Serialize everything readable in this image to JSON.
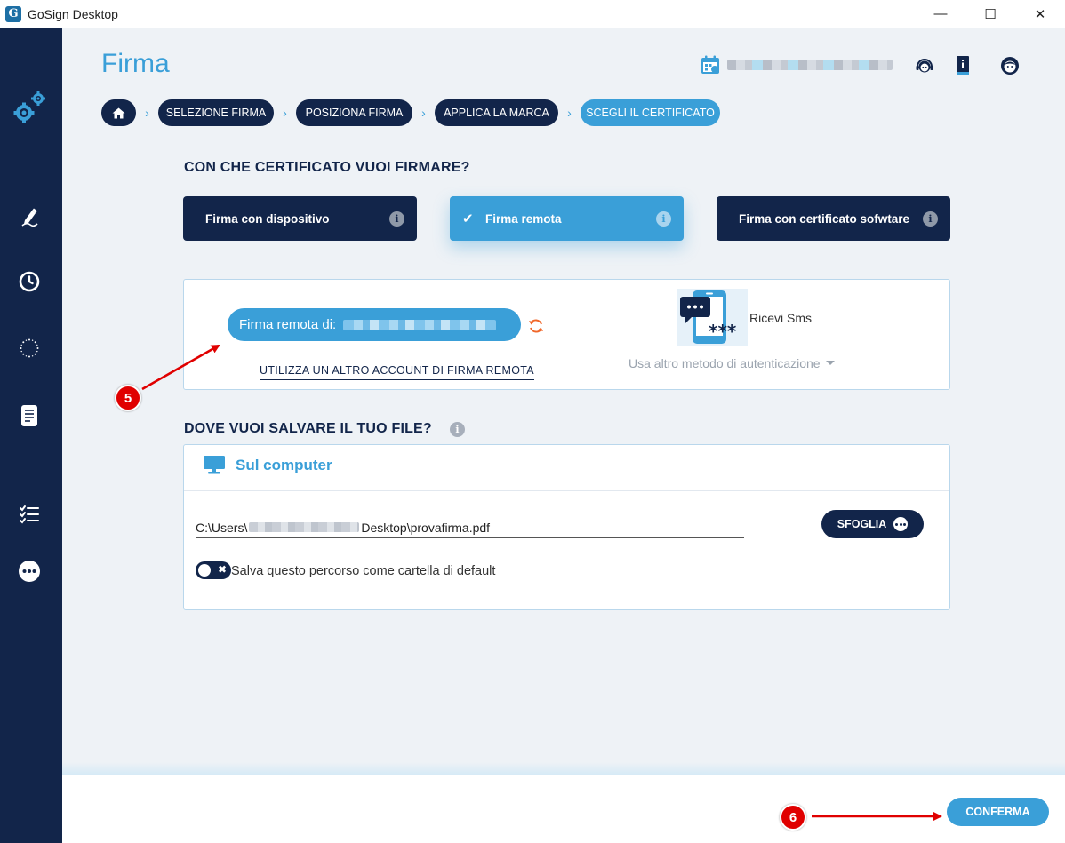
{
  "window": {
    "app_logo": "G",
    "title": "GoSign Desktop",
    "minimize": "—",
    "maximize": "☐",
    "close": "✕"
  },
  "header": {
    "page_title": "Firma"
  },
  "breadcrumb": {
    "steps": [
      "SELEZIONE FIRMA",
      "POSIZIONA FIRMA",
      "APPLICA LA MARCA",
      "SCEGLI IL CERTIFICATO"
    ],
    "separator": "›"
  },
  "certificate": {
    "question": "CON CHE CERTIFICATO VUOI FIRMARE?",
    "options": [
      {
        "label": "Firma con dispositivo",
        "selected": false
      },
      {
        "label": "Firma remota",
        "selected": true
      },
      {
        "label": "Firma con certificato sofwtare",
        "selected": false
      }
    ],
    "check_mark": "✔",
    "info_glyph": "i"
  },
  "remote": {
    "account_label": "Firma remota di:",
    "other_account_link": "UTILIZZA UN ALTRO ACCOUNT DI FIRMA REMOTA",
    "auth_method": "Ricevi Sms",
    "auth_dots": "***",
    "other_auth_method": "Usa altro metodo di autenticazione"
  },
  "save": {
    "question": "DOVE VUOI SALVARE IL TUO FILE?",
    "info_glyph": "i",
    "location_title": "Sul computer",
    "path_prefix": "C:\\Users\\",
    "path_suffix": "Desktop\\provafirma.pdf",
    "browse_label": "SFOGLIA",
    "default_toggle_label": "Salva questo percorso come cartella di default",
    "toggle_glyph": "✖",
    "default_toggle_on": false
  },
  "footer": {
    "confirm_label": "CONFERMA"
  },
  "annotations": {
    "step_5": "5",
    "step_6": "6"
  },
  "colors": {
    "primary_dark": "#12254a",
    "accent_blue": "#3a9fd8",
    "annotation_red": "#e00000",
    "refresh_orange": "#f0672a"
  }
}
